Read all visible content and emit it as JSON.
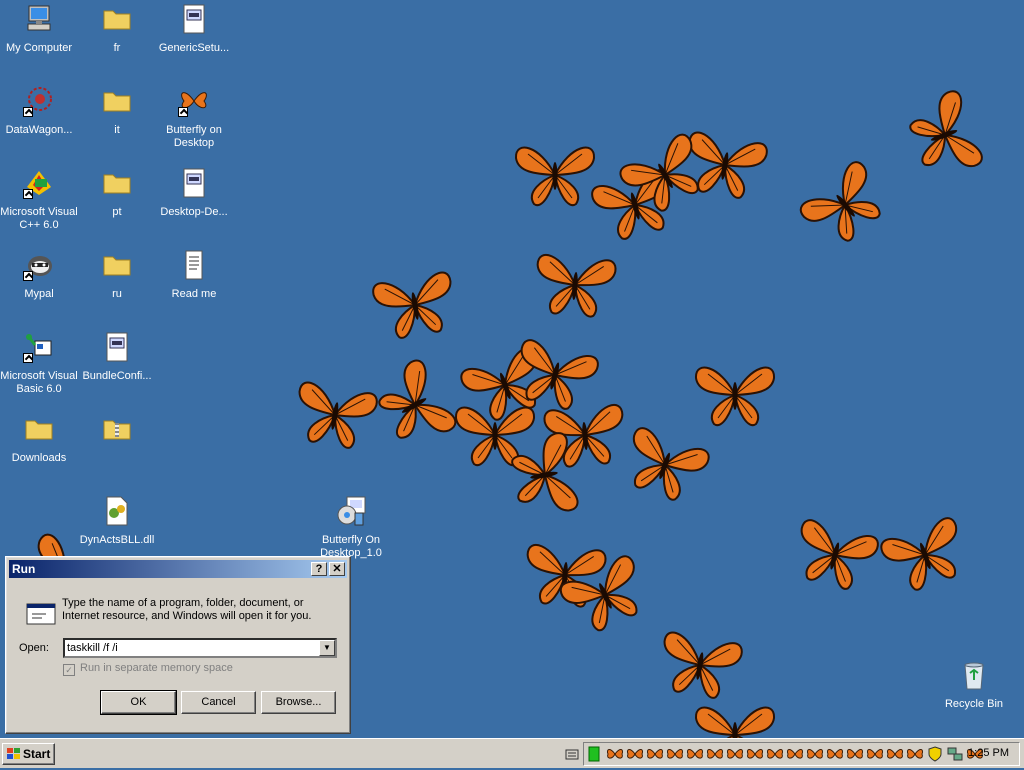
{
  "desktop": {
    "icons": [
      {
        "label": "My Computer",
        "icon": "computer-icon"
      },
      {
        "label": "fr",
        "icon": "folder-icon"
      },
      {
        "label": "GenericSetu...",
        "icon": "setup-file-icon"
      },
      {
        "label": "DataWagon...",
        "icon": "datawagon-icon"
      },
      {
        "label": "it",
        "icon": "folder-icon"
      },
      {
        "label": "Butterfly on Desktop",
        "icon": "butterfly-icon"
      },
      {
        "label": "Microsoft Visual C++ 6.0",
        "icon": "visual-cpp-icon"
      },
      {
        "label": "pt",
        "icon": "folder-icon"
      },
      {
        "label": "Desktop-De...",
        "icon": "setup-file-icon"
      },
      {
        "label": "Mypal",
        "icon": "mypal-icon"
      },
      {
        "label": "ru",
        "icon": "folder-icon"
      },
      {
        "label": "Read me",
        "icon": "text-file-icon"
      },
      {
        "label": "Microsoft Visual Basic 6.0",
        "icon": "visual-basic-icon"
      },
      {
        "label": "BundleConfi...",
        "icon": "setup-file-icon"
      },
      {
        "label": "Downloads",
        "icon": "folder-icon"
      },
      {
        "label": "",
        "icon": "zip-folder-icon"
      },
      {
        "label": "DynActsBLL.dll",
        "icon": "dll-file-icon"
      },
      {
        "label": "Butterfly On Desktop_1.0",
        "icon": "installer-icon"
      },
      {
        "label": "Recycle Bin",
        "icon": "recycle-bin-icon"
      }
    ]
  },
  "run_dialog": {
    "title": "Run",
    "help_label": "?",
    "close_label": "✕",
    "description": "Type the name of a program, folder, document, or Internet resource, and Windows will open it for you.",
    "open_label": "Open:",
    "command_value": "taskkill /f /i",
    "separate_memory_label": "Run in separate memory space",
    "ok_label": "OK",
    "cancel_label": "Cancel",
    "browse_label": "Browse..."
  },
  "taskbar": {
    "start_label": "Start",
    "clock": "1:25 PM",
    "tray_icons": [
      "green-status-icon",
      "butterfly-icon",
      "shield-icon",
      "network-icon"
    ]
  },
  "colors": {
    "desktop_bg": "#3a6ea5",
    "butterfly_orange": "#e8741c",
    "title_active": "#0a246a"
  }
}
